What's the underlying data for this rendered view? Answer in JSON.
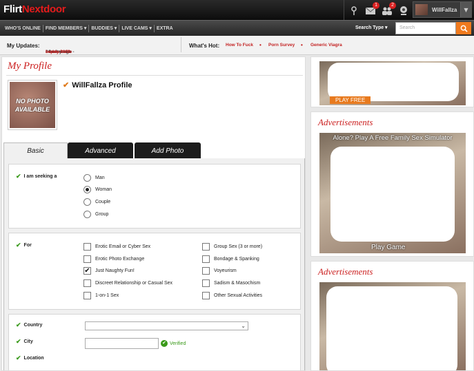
{
  "header": {
    "logo_part1": "Flirt",
    "logo_part2": "Ne",
    "logo_part3": "tdoor",
    "icons": [
      {
        "name": "signal-icon"
      },
      {
        "name": "mail-icon",
        "badge": "1"
      },
      {
        "name": "friends-icon",
        "badge": "2"
      },
      {
        "name": "webcam-icon"
      }
    ],
    "username": "WillFallza",
    "dropdown_glyph": "▼"
  },
  "nav": {
    "items": [
      "WHO'S ONLINE",
      "FIND MEMBERS ▾",
      "BUDDIES ▾",
      "LIVE CAMS ▾",
      "EXTRA"
    ],
    "search_type_label": "Search Type ▾",
    "search_placeholder": "Search"
  },
  "updates": {
    "title": "My Updates:",
    "time": "34 mins ago - ",
    "user_link": "cepero3082",
    "mid_text": " - Sent you a ",
    "action_link": "buddy invite",
    "hot_title": "What's Hot:",
    "hot_links": [
      "How To Fuck",
      "Porn Survey",
      "Generic Viagra"
    ],
    "dot": "•"
  },
  "profile": {
    "section_title": "My Profile",
    "photo_text_1": "NO PHOTO",
    "photo_text_2": "AVAILABLE",
    "name_check": "✔",
    "name": "WillFallza Profile"
  },
  "tabs": [
    "Basic",
    "Advanced",
    "Add Photo"
  ],
  "form": {
    "check_glyph": "✔",
    "seeking_label": "I am seeking a",
    "seeking_options": [
      {
        "label": "Man",
        "selected": false
      },
      {
        "label": "Woman",
        "selected": true
      },
      {
        "label": "Couple",
        "selected": false
      },
      {
        "label": "Group",
        "selected": false
      }
    ],
    "for_label": "For",
    "for_left": [
      {
        "label": "Erotic Email or Cyber Sex",
        "checked": false
      },
      {
        "label": "Erotic Photo Exchange",
        "checked": false
      },
      {
        "label": "Just Naughty Fun!",
        "checked": true
      },
      {
        "label": "Discreet Relationship or Casual Sex",
        "checked": false
      },
      {
        "label": "1-on-1 Sex",
        "checked": false
      }
    ],
    "for_right": [
      {
        "label": "Group Sex (3 or more)",
        "checked": false
      },
      {
        "label": "Bondage & Spanking",
        "checked": false
      },
      {
        "label": "Voyeurism",
        "checked": false
      },
      {
        "label": "Sadism & Masochism",
        "checked": false
      },
      {
        "label": "Other Sexual Activities",
        "checked": false
      }
    ],
    "country_label": "Country",
    "city_label": "City",
    "location_label": "Location",
    "verified_text": "Verified",
    "verified_glyph": "✔",
    "select_arrow": "⌄"
  },
  "ads": {
    "title": "Advertisements",
    "ad1_cta": "PLAY FREE",
    "ad2_headline": "Alone? Play A Free Family Sex Simulator",
    "ad2_cta": "Play Game"
  },
  "colors": {
    "brand_red": "#e41b1b",
    "link_red": "#c32121",
    "search_orange": "#f07a1e",
    "verified_green": "#3a9a1a"
  }
}
